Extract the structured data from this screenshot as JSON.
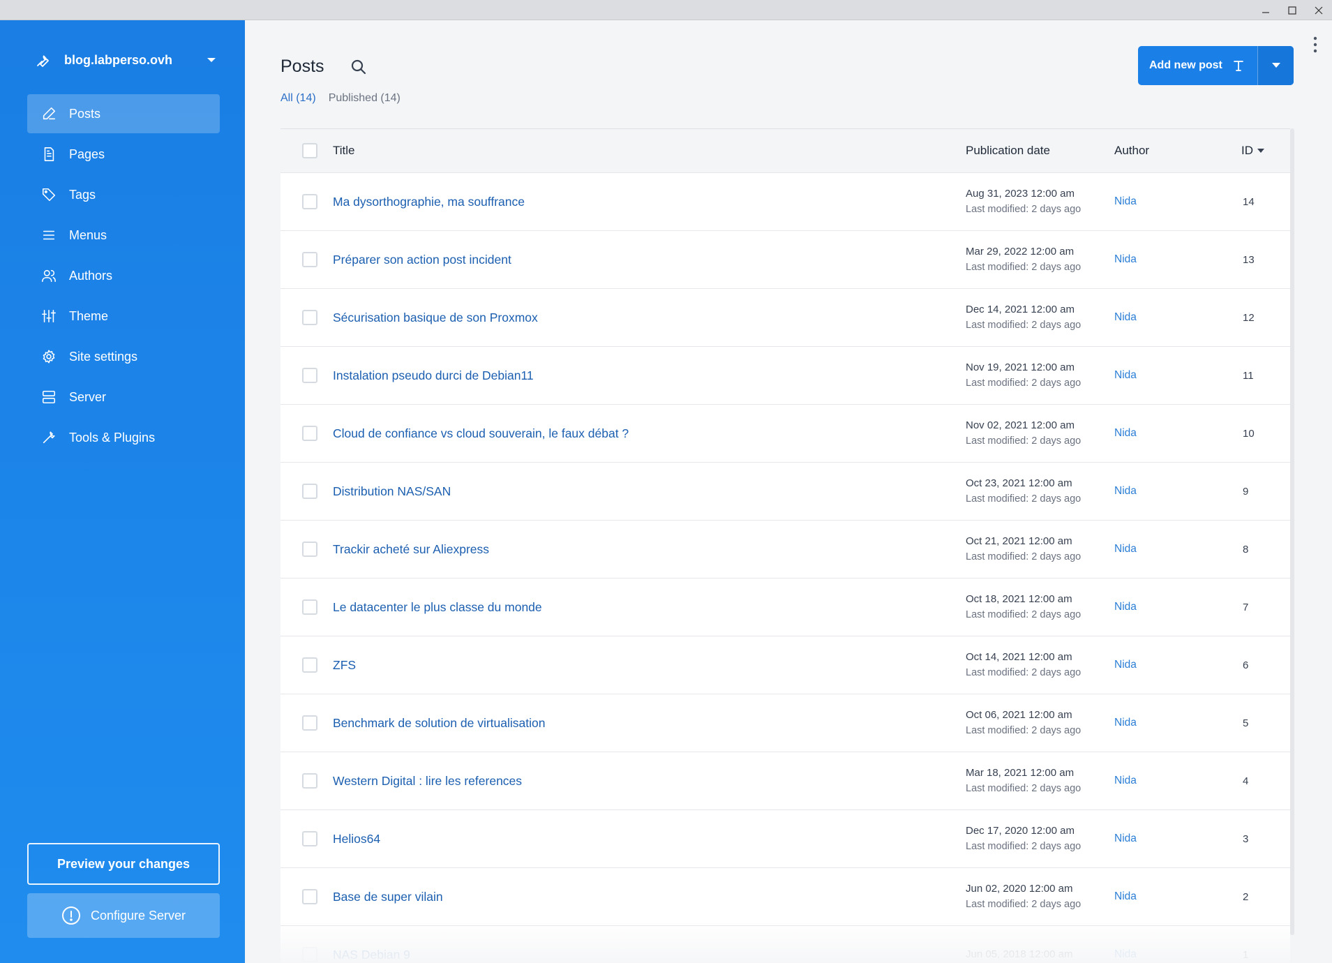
{
  "window": {
    "controls": [
      "minimize-icon",
      "maximize-icon",
      "close-icon"
    ]
  },
  "sidebar": {
    "site_name": "blog.labperso.ovh",
    "items": [
      {
        "label": "Posts",
        "icon": "pen-icon",
        "active": true
      },
      {
        "label": "Pages",
        "icon": "page-icon"
      },
      {
        "label": "Tags",
        "icon": "tag-icon"
      },
      {
        "label": "Menus",
        "icon": "menu-icon"
      },
      {
        "label": "Authors",
        "icon": "users-icon"
      },
      {
        "label": "Theme",
        "icon": "sliders-icon"
      },
      {
        "label": "Site settings",
        "icon": "gear-icon"
      },
      {
        "label": "Server",
        "icon": "server-icon"
      },
      {
        "label": "Tools & Plugins",
        "icon": "wrench-icon"
      }
    ],
    "preview_label": "Preview your changes",
    "configure_label": "Configure Server"
  },
  "header": {
    "title": "Posts",
    "add_label": "Add new post",
    "filters": {
      "all": "All (14)",
      "published": "Published (14)"
    }
  },
  "table": {
    "columns": {
      "title": "Title",
      "date": "Publication date",
      "author": "Author",
      "id": "ID"
    },
    "rows": [
      {
        "title": "Ma dysorthographie, ma souffrance",
        "date": "Aug 31, 2023 12:00 am",
        "modified": "Last modified: 2 days ago",
        "author": "Nida",
        "id": "14"
      },
      {
        "title": "Préparer son action post incident",
        "date": "Mar 29, 2022 12:00 am",
        "modified": "Last modified: 2 days ago",
        "author": "Nida",
        "id": "13"
      },
      {
        "title": "Sécurisation basique de son Proxmox",
        "date": "Dec 14, 2021 12:00 am",
        "modified": "Last modified: 2 days ago",
        "author": "Nida",
        "id": "12"
      },
      {
        "title": "Instalation pseudo durci de Debian11",
        "date": "Nov 19, 2021 12:00 am",
        "modified": "Last modified: 2 days ago",
        "author": "Nida",
        "id": "11"
      },
      {
        "title": "Cloud de confiance vs cloud souverain, le faux débat ?",
        "date": "Nov 02, 2021 12:00 am",
        "modified": "Last modified: 2 days ago",
        "author": "Nida",
        "id": "10"
      },
      {
        "title": "Distribution NAS/SAN",
        "date": "Oct 23, 2021 12:00 am",
        "modified": "Last modified: 2 days ago",
        "author": "Nida",
        "id": "9"
      },
      {
        "title": "Trackir acheté sur Aliexpress",
        "date": "Oct 21, 2021 12:00 am",
        "modified": "Last modified: 2 days ago",
        "author": "Nida",
        "id": "8"
      },
      {
        "title": "Le datacenter le plus classe du monde",
        "date": "Oct 18, 2021 12:00 am",
        "modified": "Last modified: 2 days ago",
        "author": "Nida",
        "id": "7"
      },
      {
        "title": "ZFS",
        "date": "Oct 14, 2021 12:00 am",
        "modified": "Last modified: 2 days ago",
        "author": "Nida",
        "id": "6"
      },
      {
        "title": "Benchmark de solution de virtualisation",
        "date": "Oct 06, 2021 12:00 am",
        "modified": "Last modified: 2 days ago",
        "author": "Nida",
        "id": "5"
      },
      {
        "title": "Western Digital : lire les references",
        "date": "Mar 18, 2021 12:00 am",
        "modified": "Last modified: 2 days ago",
        "author": "Nida",
        "id": "4"
      },
      {
        "title": "Helios64",
        "date": "Dec 17, 2020 12:00 am",
        "modified": "Last modified: 2 days ago",
        "author": "Nida",
        "id": "3"
      },
      {
        "title": "Base de super vilain",
        "date": "Jun 02, 2020 12:00 am",
        "modified": "Last modified: 2 days ago",
        "author": "Nida",
        "id": "2"
      },
      {
        "title": "NAS Debian 9",
        "date": "Jun 05, 2018 12:00 am",
        "modified": "",
        "author": "Nida",
        "id": "1"
      }
    ]
  },
  "colors": {
    "sidebar": "#1a7ee4",
    "accent": "#1a7fe6",
    "link": "#1c5fb0"
  }
}
